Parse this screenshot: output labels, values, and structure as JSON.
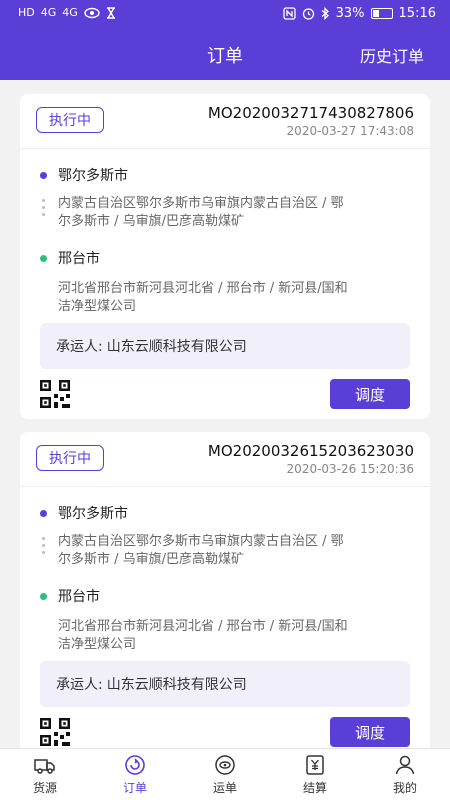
{
  "status_bar": {
    "left_indicators": [
      "HD",
      "4G",
      "4G"
    ],
    "battery": "33%",
    "time": "15:16"
  },
  "header": {
    "title": "订单",
    "history_link": "历史订单"
  },
  "orders": [
    {
      "status": "执行中",
      "order_no": "MO2020032717430827806",
      "time": "2020-03-27 17:43:08",
      "from_city": "鄂尔多斯市",
      "from_address_line1": "内蒙古自治区鄂尔多斯市乌审旗内蒙古自治区 / 鄂",
      "from_address_line2": "尔多斯市 / 乌审旗/巴彦高勒煤矿",
      "to_city": "邢台市",
      "to_address_line1": "河北省邢台市新河县河北省 / 邢台市 / 新河县/国和",
      "to_address_line2": "洁净型煤公司",
      "carrier_label": "承运人:",
      "carrier": "山东云顺科技有限公司",
      "dispatch_label": "调度"
    },
    {
      "status": "执行中",
      "order_no": "MO2020032615203623030",
      "time": "2020-03-26 15:20:36",
      "from_city": "鄂尔多斯市",
      "from_address_line1": "内蒙古自治区鄂尔多斯市乌审旗内蒙古自治区 / 鄂",
      "from_address_line2": "尔多斯市 / 乌审旗/巴彦高勒煤矿",
      "to_city": "邢台市",
      "to_address_line1": "河北省邢台市新河县河北省 / 邢台市 / 新河县/国和",
      "to_address_line2": "洁净型煤公司",
      "carrier_label": "承运人:",
      "carrier": "山东云顺科技有限公司",
      "dispatch_label": "调度"
    }
  ],
  "tabbar": {
    "items": [
      {
        "label": "货源",
        "icon": "truck-icon"
      },
      {
        "label": "订单",
        "icon": "order-icon",
        "active": true
      },
      {
        "label": "运单",
        "icon": "waybill-icon"
      },
      {
        "label": "结算",
        "icon": "settlement-icon"
      },
      {
        "label": "我的",
        "icon": "profile-icon"
      }
    ]
  },
  "colors": {
    "primary": "#5b3ed6",
    "start_dot": "#5b3ed6",
    "end_dot": "#2bbf7f",
    "carrier_bg": "#f0effa"
  }
}
